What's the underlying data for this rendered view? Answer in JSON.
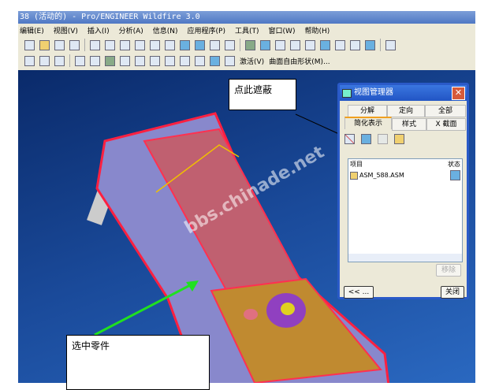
{
  "window": {
    "title": "38 (活动的) - Pro/ENGINEER Wildfire 3.0"
  },
  "menu": [
    "编辑(E)",
    "视图(V)",
    "插入(I)",
    "分析(A)",
    "信息(N)",
    "应用程序(P)",
    "工具(T)",
    "窗口(W)",
    "帮助(H)"
  ],
  "toolbar2": {
    "activate": "激活(V)",
    "freeform": "曲面自由形状(M)..."
  },
  "dialog": {
    "title": "视图管理器",
    "tabs_row1": [
      "分解",
      "定向",
      "全部"
    ],
    "tabs_row2": [
      "简化表示",
      "样式",
      "X 截面"
    ],
    "list_header": [
      "项目",
      "状态"
    ],
    "items": [
      "ASM_588.ASM"
    ],
    "remove": "移除",
    "back": "<< ...",
    "close": "关闭"
  },
  "annotations": {
    "hide_note": "点此遮蔽",
    "select_note": "选中零件"
  },
  "watermark": "bbs.chinade.net"
}
